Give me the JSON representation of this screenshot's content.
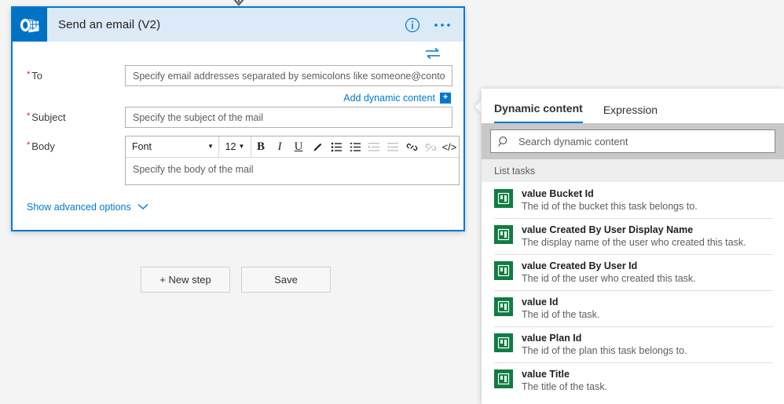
{
  "connector": {
    "arrow_icon": "chevron-down-arrow-icon"
  },
  "card": {
    "title": "Send an email (V2)",
    "app_icon": "outlook-icon",
    "info_icon": "info-circle-icon",
    "more_icon": "ellipsis-icon",
    "swap_icon": "swap-arrows-icon",
    "fields": [
      {
        "label": "To",
        "required": true,
        "placeholder": "Specify email addresses separated by semicolons like someone@contoso.com"
      },
      {
        "label": "Subject",
        "required": true,
        "placeholder": "Specify the subject of the mail"
      },
      {
        "label": "Body",
        "required": true,
        "placeholder": "Specify the body of the mail"
      }
    ],
    "add_dynamic_content": {
      "label": "Add dynamic content",
      "badge": "+",
      "badge_icon": "add-plus-icon"
    },
    "editor": {
      "font_label": "Font",
      "font_caret_icon": "chevron-down-icon",
      "size_label": "12",
      "size_caret_icon": "chevron-down-icon",
      "buttons": [
        {
          "name": "bold-icon",
          "glyph": "B",
          "disabled": false
        },
        {
          "name": "italic-icon",
          "glyph": "I",
          "disabled": false
        },
        {
          "name": "underline-icon",
          "glyph": "U",
          "disabled": false
        },
        {
          "name": "text-color-pen-icon",
          "glyph": "",
          "disabled": false
        },
        {
          "name": "bulleted-list-icon",
          "glyph": "",
          "disabled": false
        },
        {
          "name": "numbered-list-icon",
          "glyph": "",
          "disabled": false
        },
        {
          "name": "decrease-indent-icon",
          "glyph": "",
          "disabled": true
        },
        {
          "name": "increase-indent-icon",
          "glyph": "",
          "disabled": true
        },
        {
          "name": "insert-link-icon",
          "glyph": "",
          "disabled": false
        },
        {
          "name": "remove-link-icon",
          "glyph": "",
          "disabled": true
        },
        {
          "name": "code-view-icon",
          "glyph": "</>",
          "disabled": false
        }
      ]
    },
    "show_advanced": {
      "label": "Show advanced options",
      "chevron_icon": "chevron-down-icon"
    }
  },
  "actions": {
    "new_step_label": "+ New step",
    "save_label": "Save"
  },
  "dynamic_panel": {
    "tabs": [
      {
        "label": "Dynamic content",
        "active": true
      },
      {
        "label": "Expression",
        "active": false
      }
    ],
    "search": {
      "placeholder": "Search dynamic content",
      "value": "",
      "icon": "search-icon"
    },
    "group_header": "List tasks",
    "items": [
      {
        "title": "value Bucket Id",
        "description": "The id of the bucket this task belongs to.",
        "icon": "planner-icon"
      },
      {
        "title": "value Created By User Display Name",
        "description": "The display name of the user who created this task.",
        "icon": "planner-icon"
      },
      {
        "title": "value Created By User Id",
        "description": "The id of the user who created this task.",
        "icon": "planner-icon"
      },
      {
        "title": "value Id",
        "description": "The id of the task.",
        "icon": "planner-icon"
      },
      {
        "title": "value Plan Id",
        "description": "The id of the plan this task belongs to.",
        "icon": "planner-icon"
      },
      {
        "title": "value Title",
        "description": "The title of the task.",
        "icon": "planner-icon"
      }
    ]
  },
  "colors": {
    "accent": "#0078d4",
    "outlook_blue": "#0072c6",
    "planner_green": "#107c41",
    "required_red": "#e81123",
    "page_bg": "#f4f4f4"
  }
}
